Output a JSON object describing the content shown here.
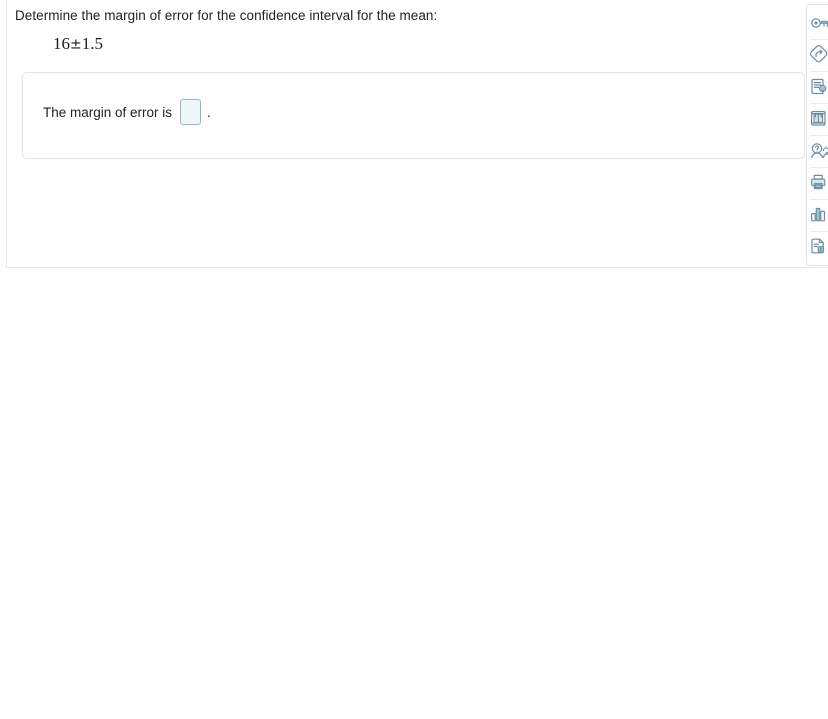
{
  "question": {
    "prompt": "Determine the margin of error for the confidence interval for the mean:",
    "expression": {
      "value": "16",
      "plus_minus": "±",
      "margin": "1.5",
      "full": "16±1.5"
    }
  },
  "answer": {
    "label": "The margin of error is",
    "input_value": "",
    "input_placeholder": "",
    "trailing_punctuation": "."
  },
  "toolbar": {
    "items": [
      {
        "icon": "key-icon",
        "label": "Answer key"
      },
      {
        "icon": "diamond-arrow-icon",
        "label": "Try similar question"
      },
      {
        "icon": "document-lightbulb-icon",
        "label": "View hint"
      },
      {
        "icon": "textbook-icon",
        "label": "Open textbook reference"
      },
      {
        "icon": "person-question-icon",
        "label": "Ask my instructor"
      },
      {
        "icon": "printer-icon",
        "label": "Print question"
      },
      {
        "icon": "bar-chart-icon",
        "label": "Statistics tool"
      },
      {
        "icon": "document-info-icon",
        "label": "Question details"
      }
    ]
  },
  "colors": {
    "input_border": "#8fb6c2",
    "input_fill": "#eef6fa",
    "card_border": "#e3e3e3",
    "icon_stroke": "#6e8ca0",
    "icon_accent": "#9cc3d3",
    "text": "#222222",
    "background": "#ffffff"
  }
}
